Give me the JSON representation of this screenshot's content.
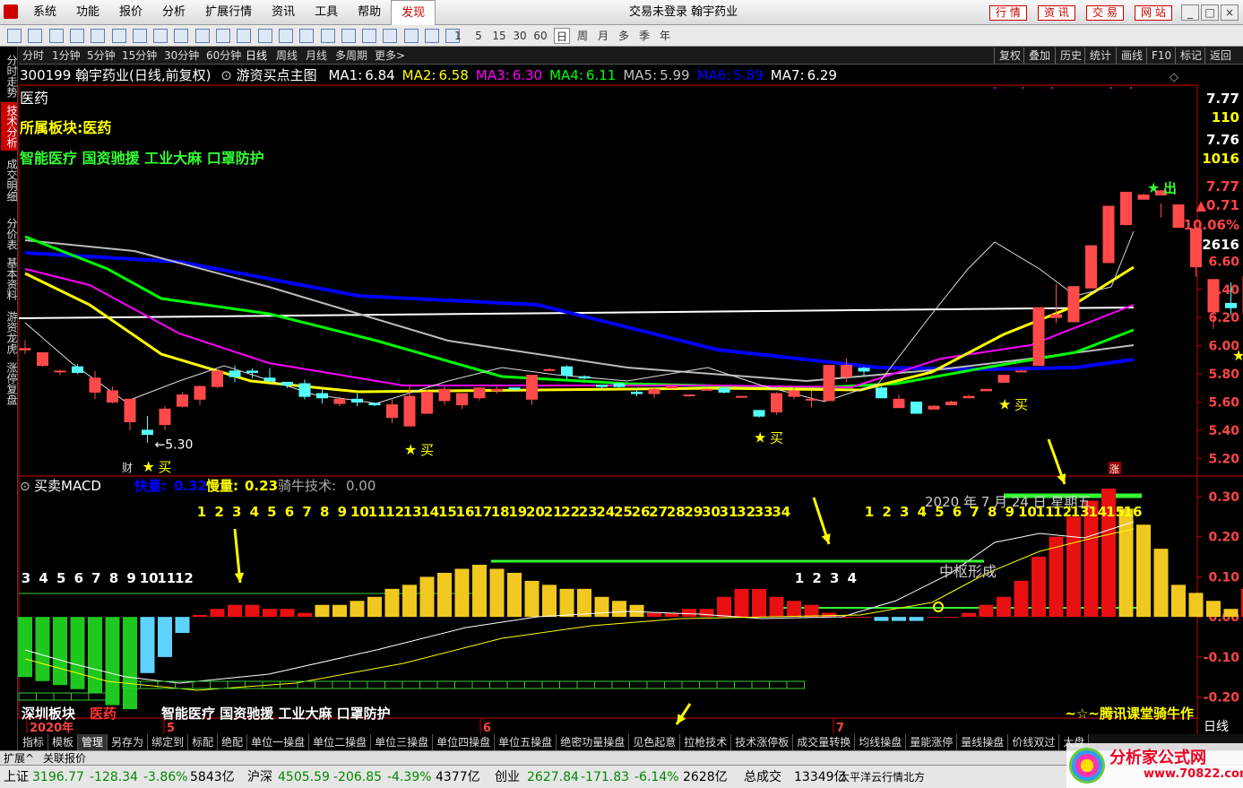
{
  "menu": {
    "items": [
      "系统",
      "功能",
      "报价",
      "分析",
      "扩展行情",
      "资讯",
      "工具",
      "帮助",
      "发现"
    ],
    "active": "发现",
    "title": "交易未登录  翰宇药业",
    "right": [
      "行 情",
      "资 讯",
      "交 易",
      "网 站"
    ]
  },
  "toolbar": {
    "nums": [
      "1",
      "5",
      "15",
      "30",
      "60"
    ],
    "periods": [
      "日",
      "周",
      "月",
      "多",
      "季",
      "年"
    ]
  },
  "leftbar": [
    "分时走势",
    "技术分析",
    "成交明细",
    "分价表",
    "基本资料",
    "游资龙虎",
    "涨停复盘"
  ],
  "leftbar_active": "技术分析",
  "periods": [
    "分时",
    "1分钟",
    "5分钟",
    "15分钟",
    "30分钟",
    "60分钟",
    "日线",
    "周线",
    "月线",
    "多周期",
    "更多>"
  ],
  "period_selected": "日线",
  "right_buttons": [
    "复权",
    "叠加",
    "历史",
    "统计",
    "画线",
    "F10",
    "标记",
    "返回"
  ],
  "stock": {
    "code_name": "300199 翰宇药业(日线,前复权)",
    "indicator": "游资买点主图",
    "industry": "医药",
    "ma": [
      {
        "label": "MA1",
        "value": "6.84",
        "color": "#ffffff"
      },
      {
        "label": "MA2",
        "value": "6.58",
        "color": "#ffff00"
      },
      {
        "label": "MA3",
        "value": "6.30",
        "color": "#ff00ff"
      },
      {
        "label": "MA4",
        "value": "6.11",
        "color": "#00ff00"
      },
      {
        "label": "MA5",
        "value": "5.99",
        "color": "#c0c0c0"
      },
      {
        "label": "MA6",
        "value": "5.89",
        "color": "#0000ff"
      },
      {
        "label": "MA7",
        "value": "6.29",
        "color": "#ffffff"
      }
    ],
    "sector": "所属板块:医药",
    "concepts": "智能医疗 国资驰援 工业大麻 口罩防护",
    "low_label": "←5.30",
    "high_label": "7.77—",
    "buy": "买",
    "sell": "出",
    "rich": "财",
    "zhang": "涨"
  },
  "right_quote": [
    "7.77",
    "110",
    "7.76",
    "1016",
    "7.77",
    "▲0.71",
    "10.06%",
    "2616"
  ],
  "price_axis": [
    "6.60",
    "6.40",
    "6.20",
    "6.00",
    "5.80",
    "5.60",
    "5.40",
    "5.20"
  ],
  "sub": {
    "title": "买卖MACD",
    "fast_label": "快量:",
    "fast": "0.32",
    "slow_label": "慢量:",
    "slow": "0.23",
    "tech_label": "骑牛技术:",
    "tech": "0.00",
    "axis": [
      "0.30",
      "0.20",
      "0.10",
      "0.00",
      "-0.10",
      "-0.20"
    ],
    "center_label": "中枢形成",
    "date_label": "2020 年 7 月 24 日 星期五",
    "seq_left": [
      "3",
      "4",
      "5",
      "6",
      "7",
      "8",
      "9",
      "10",
      "11",
      "12"
    ],
    "seq_mid": [
      "1",
      "2",
      "3",
      "4",
      "5",
      "6",
      "7",
      "8",
      "9",
      "10",
      "11",
      "12",
      "13",
      "14",
      "15",
      "16",
      "17",
      "18",
      "19",
      "20",
      "21",
      "22",
      "23",
      "24",
      "25",
      "26",
      "27",
      "28",
      "29",
      "30",
      "31",
      "32",
      "33",
      "34"
    ],
    "seq_small": [
      "1",
      "2",
      "3",
      "4"
    ],
    "seq_right": [
      "1",
      "2",
      "3",
      "4",
      "5",
      "6",
      "7",
      "8",
      "9",
      "10",
      "11",
      "12",
      "13",
      "14",
      "15",
      "16"
    ],
    "footer_sector": "深圳板块",
    "footer_industry": "医药",
    "footer_concepts": "智能医疗 国资驰援 工业大麻 口罩防护",
    "footer_right": "~☆~腾讯课堂骑牛作"
  },
  "xaxis": {
    "labels": [
      "2020年",
      "5",
      "6",
      "7"
    ],
    "right": "日线"
  },
  "bottom_tabs": [
    "指标",
    "模板",
    "管理",
    "另存为",
    "绑定到",
    "标配",
    "绝配",
    "单位一操盘",
    "单位二操盘",
    "单位三操盘",
    "单位四操盘",
    "单位五操盘",
    "绝密功量操盘",
    "见色起意",
    "拉枪技术",
    "技术涨停板",
    "成交量转换",
    "均线操盘",
    "量能涨停",
    "量线操盘",
    "价线双过",
    "大盘"
  ],
  "bottom_tab_selected": "管理",
  "status1": [
    "扩展^",
    "关联报价"
  ],
  "status2": {
    "sh_label": "上证",
    "sh": "3196.77",
    "sh_chg": "-128.34",
    "sh_pct": "-3.86%",
    "sh_amt": "5843亿",
    "hs_label": "沪深",
    "hs": "4505.59",
    "hs_chg": "-206.85",
    "hs_pct": "-4.39%",
    "hs_amt": "4377亿",
    "cy_label": "创业",
    "cy": "2627.84",
    "cy_chg": "-171.83",
    "cy_pct": "-6.14%",
    "cy_amt": "2628亿",
    "total_label": "总成交",
    "total": "13349亿",
    "extra": "太平洋云行情北方"
  },
  "watermark": {
    "t1": "分析家公式网",
    "t2": "www.70822.com"
  },
  "chart_data": [
    {
      "type": "candlestick",
      "title": "300199 翰宇药业(日线,前复权)",
      "ylim": [
        5.1,
        7.85
      ],
      "low_mark": 5.3,
      "high_mark": 7.77,
      "x": [
        "2020-04",
        "2020-05",
        "2020-06",
        "2020-07"
      ],
      "ohlc": [
        [
          5.97,
          6.04,
          5.94,
          5.98
        ],
        [
          5.86,
          5.95,
          5.85,
          5.95
        ],
        [
          5.82,
          5.83,
          5.79,
          5.82
        ],
        [
          5.85,
          5.87,
          5.8,
          5.81
        ],
        [
          5.67,
          5.82,
          5.62,
          5.77
        ],
        [
          5.6,
          5.71,
          5.59,
          5.68
        ],
        [
          5.46,
          5.62,
          5.4,
          5.62
        ],
        [
          5.4,
          5.5,
          5.31,
          5.37
        ],
        [
          5.44,
          5.57,
          5.4,
          5.55
        ],
        [
          5.57,
          5.67,
          5.56,
          5.65
        ],
        [
          5.62,
          5.72,
          5.58,
          5.71
        ],
        [
          5.71,
          5.83,
          5.7,
          5.82
        ],
        [
          5.82,
          5.86,
          5.74,
          5.78
        ],
        [
          5.82,
          5.84,
          5.77,
          5.81
        ],
        [
          5.77,
          5.84,
          5.74,
          5.75
        ],
        [
          5.74,
          5.74,
          5.7,
          5.72
        ],
        [
          5.73,
          5.76,
          5.62,
          5.64
        ],
        [
          5.66,
          5.69,
          5.59,
          5.63
        ],
        [
          5.59,
          5.64,
          5.57,
          5.62
        ],
        [
          5.62,
          5.66,
          5.57,
          5.6
        ],
        [
          5.59,
          5.59,
          5.57,
          5.58
        ],
        [
          5.49,
          5.62,
          5.45,
          5.58
        ],
        [
          5.43,
          5.71,
          5.43,
          5.64
        ],
        [
          5.52,
          5.69,
          5.52,
          5.67
        ],
        [
          5.61,
          5.71,
          5.58,
          5.69
        ],
        [
          5.58,
          5.66,
          5.55,
          5.66
        ],
        [
          5.63,
          5.7,
          5.61,
          5.7
        ],
        [
          5.68,
          5.71,
          5.66,
          5.69
        ],
        [
          5.7,
          5.7,
          5.69,
          5.69
        ],
        [
          5.62,
          5.78,
          5.58,
          5.79
        ],
        [
          5.83,
          5.84,
          5.82,
          5.83
        ],
        [
          5.85,
          5.86,
          5.76,
          5.79
        ],
        [
          5.78,
          5.79,
          5.76,
          5.77
        ],
        [
          5.72,
          5.72,
          5.69,
          5.71
        ],
        [
          5.73,
          5.74,
          5.7,
          5.71
        ],
        [
          5.67,
          5.7,
          5.64,
          5.66
        ],
        [
          5.66,
          5.7,
          5.63,
          5.69
        ],
        [
          5.7,
          5.73,
          5.7,
          5.71
        ],
        [
          5.65,
          5.65,
          5.65,
          5.65
        ],
        [
          5.69,
          5.7,
          5.69,
          5.69
        ],
        [
          5.7,
          5.7,
          5.66,
          5.67
        ],
        [
          5.64,
          5.64,
          5.63,
          5.64
        ],
        [
          5.54,
          5.54,
          5.49,
          5.5
        ],
        [
          5.53,
          5.67,
          5.51,
          5.66
        ],
        [
          5.64,
          5.7,
          5.62,
          5.68
        ],
        [
          5.62,
          5.68,
          5.56,
          5.62
        ],
        [
          5.61,
          5.83,
          5.61,
          5.86
        ],
        [
          5.78,
          5.91,
          5.74,
          5.86
        ],
        [
          5.84,
          5.85,
          5.78,
          5.82
        ],
        [
          5.7,
          5.71,
          5.63,
          5.63
        ],
        [
          5.56,
          5.65,
          5.56,
          5.62
        ],
        [
          5.6,
          5.6,
          5.52,
          5.52
        ],
        [
          5.55,
          5.58,
          5.55,
          5.57
        ],
        [
          5.58,
          5.61,
          5.58,
          5.6
        ],
        [
          5.63,
          5.65,
          5.63,
          5.64
        ],
        [
          5.68,
          5.69,
          5.68,
          5.69
        ],
        [
          5.74,
          5.79,
          5.74,
          5.79
        ],
        [
          5.82,
          5.83,
          5.81,
          5.82
        ],
        [
          5.86,
          6.27,
          5.86,
          6.27
        ],
        [
          6.2,
          6.44,
          6.16,
          6.22
        ],
        [
          6.17,
          6.37,
          6.19,
          6.42
        ],
        [
          6.41,
          6.48,
          6.41,
          6.71
        ],
        [
          6.59,
          6.95,
          6.62,
          6.99
        ],
        [
          6.86,
          7.03,
          6.85,
          7.09
        ],
        [
          7.04,
          7.04,
          7.08,
          7.07
        ],
        [
          7.07,
          7.01,
          6.91,
          7.1
        ],
        [
          6.84,
          7.0,
          6.84,
          7.0
        ],
        [
          6.56,
          6.84,
          6.49,
          6.83
        ],
        [
          6.24,
          6.46,
          6.12,
          6.47
        ],
        [
          6.3,
          6.45,
          6.22,
          6.27
        ],
        [
          6.23,
          6.48,
          6.2,
          6.49
        ],
        [
          6.47,
          6.56,
          6.44,
          6.5
        ],
        [
          6.46,
          6.5,
          6.44,
          6.47
        ],
        [
          6.43,
          6.5,
          6.42,
          6.48
        ],
        [
          6.41,
          7.05,
          6.41,
          7.05
        ],
        [
          7.05,
          7.77,
          7.05,
          7.77
        ]
      ],
      "buy_signals": [
        7,
        22,
        42,
        56
      ],
      "sell_signals": [
        64
      ]
    },
    {
      "type": "bar",
      "title": "买卖MACD",
      "ylim": [
        -0.25,
        0.32
      ],
      "values": [
        -0.15,
        -0.16,
        -0.17,
        -0.18,
        -0.19,
        -0.22,
        -0.23,
        -0.14,
        -0.1,
        -0.04,
        0.005,
        0.02,
        0.03,
        0.03,
        0.02,
        0.02,
        0.01,
        0.03,
        0.03,
        0.04,
        0.05,
        0.07,
        0.08,
        0.1,
        0.11,
        0.12,
        0.13,
        0.12,
        0.11,
        0.09,
        0.08,
        0.07,
        0.07,
        0.05,
        0.04,
        0.03,
        0.01,
        0.01,
        0.02,
        0.02,
        0.05,
        0.07,
        0.07,
        0.05,
        0.04,
        0.03,
        0.01,
        0.0,
        0.0,
        -0.01,
        -0.01,
        -0.01,
        0.0,
        0.0,
        0.01,
        0.03,
        0.05,
        0.09,
        0.15,
        0.2,
        0.25,
        0.29,
        0.32,
        0.27,
        0.23,
        0.17,
        0.08,
        0.06,
        0.04,
        0.02,
        0.07,
        0.19
      ]
    }
  ]
}
